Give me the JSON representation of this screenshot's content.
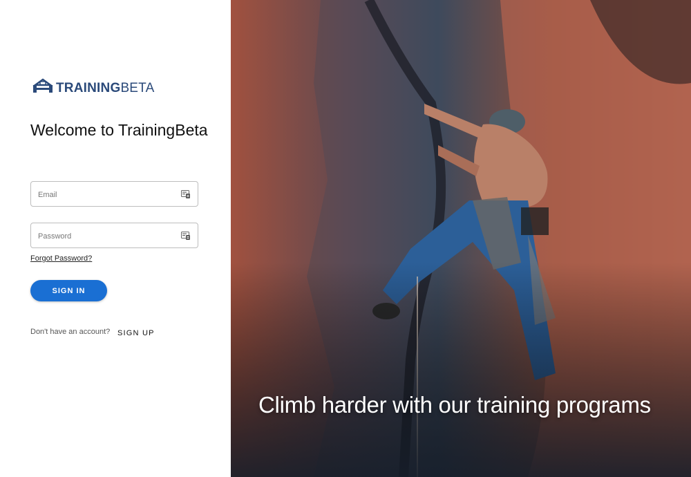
{
  "brand": {
    "logo_main": "TRAINING",
    "logo_accent": "BETA",
    "logo_color": "#2b4a7a"
  },
  "login": {
    "title": "Welcome to TrainingBeta",
    "email_placeholder": "Email",
    "email_value": "",
    "password_placeholder": "Password",
    "password_value": "",
    "field_icon": "password-manager-key-icon",
    "forgot_link": "Forgot Password?",
    "signin_button": "SIGN IN",
    "signin_color": "#1a6fd3",
    "no_account_text": "Don't have an account?",
    "signup_link": "SIGN UP"
  },
  "hero": {
    "image_subject": "rock-climber-photo",
    "tagline": "Climb harder with our training programs"
  }
}
